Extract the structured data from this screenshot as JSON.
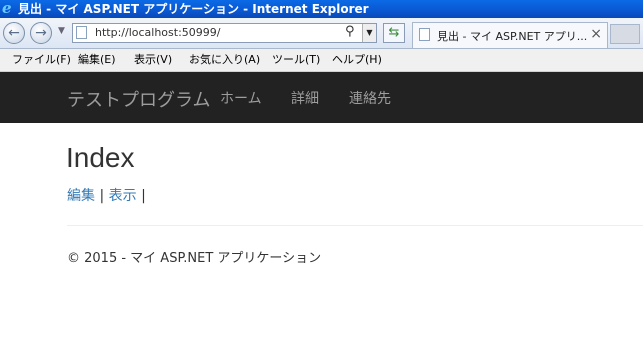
{
  "window": {
    "title": "見出 - マイ ASP.NET アプリケーション - Internet Explorer"
  },
  "browser": {
    "address": "http://localhost:50999/",
    "tab_title": "見出 - マイ ASP.NET アプリ...",
    "back_icon": "back-arrow-icon",
    "forward_icon": "forward-arrow-icon"
  },
  "menu": {
    "items": [
      "ファイル(F)",
      "編集(E)",
      "表示(V)",
      "お気に入り(A)",
      "ツール(T)",
      "ヘルプ(H)"
    ]
  },
  "site": {
    "brand": "テストプログラム",
    "nav": [
      "ホーム",
      "詳細",
      "連絡先"
    ]
  },
  "page": {
    "heading": "Index",
    "edit_link": "編集",
    "view_link": "表示",
    "separator": "|"
  },
  "footer": {
    "text": "© 2015 - マイ ASP.NET アプリケーション"
  },
  "colors": {
    "navbar_bg": "#222222",
    "link": "#337ab7",
    "titlebar": "#0a57d1"
  }
}
